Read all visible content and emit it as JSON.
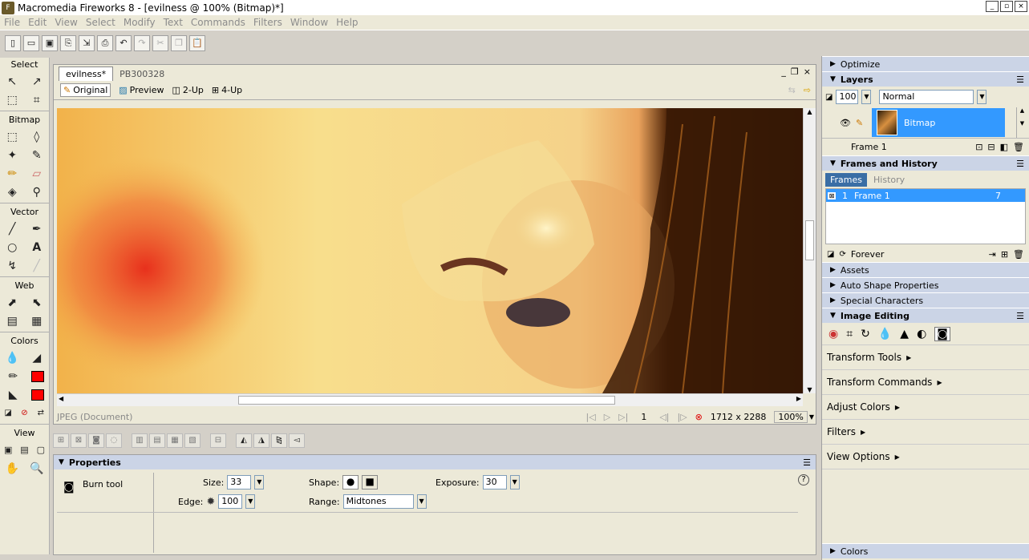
{
  "window": {
    "title": "Macromedia Fireworks 8 - [evilness @ 100% (Bitmap)*]",
    "buttons": [
      "_",
      "▫",
      "×"
    ]
  },
  "menu": [
    "File",
    "Edit",
    "View",
    "Select",
    "Modify",
    "Text",
    "Commands",
    "Filters",
    "Window",
    "Help"
  ],
  "tools": {
    "select": "Select",
    "bitmap": "Bitmap",
    "vector": "Vector",
    "web": "Web",
    "colors": "Colors",
    "view": "View"
  },
  "document": {
    "tabs": [
      "evilness*",
      "PB300328"
    ],
    "views": [
      "Original",
      "Preview",
      "2-Up",
      "4-Up"
    ],
    "status_type": "JPEG (Document)",
    "frame": "1",
    "size": "1712 x 2288",
    "zoom": "100%"
  },
  "properties": {
    "title": "Properties",
    "tool_name": "Burn tool",
    "size_label": "Size:",
    "size": "33",
    "edge_label": "Edge:",
    "edge": "100",
    "shape_label": "Shape:",
    "range_label": "Range:",
    "range": "Midtones",
    "exposure_label": "Exposure:",
    "exposure": "30"
  },
  "right": {
    "optimize": "Optimize",
    "layers": "Layers",
    "opacity": "100",
    "blend": "Normal",
    "layer_name": "Bitmap",
    "frame_name": "Frame 1",
    "frames_history": "Frames and History",
    "tab_frames": "Frames",
    "tab_history": "History",
    "frame_row": {
      "num": "1",
      "name": "Frame 1",
      "delay": "7"
    },
    "loop": "Forever",
    "assets": "Assets",
    "auto_shape": "Auto Shape Properties",
    "special_chars": "Special Characters",
    "image_editing": "Image Editing",
    "ie_items": [
      "Transform Tools",
      "Transform Commands",
      "Adjust Colors",
      "Filters",
      "View Options"
    ],
    "colors": "Colors"
  },
  "colors": {
    "stroke": "#ff0000",
    "fill": "#ff0000",
    "panel": "#cbd4e6",
    "selection": "#3399ff"
  }
}
